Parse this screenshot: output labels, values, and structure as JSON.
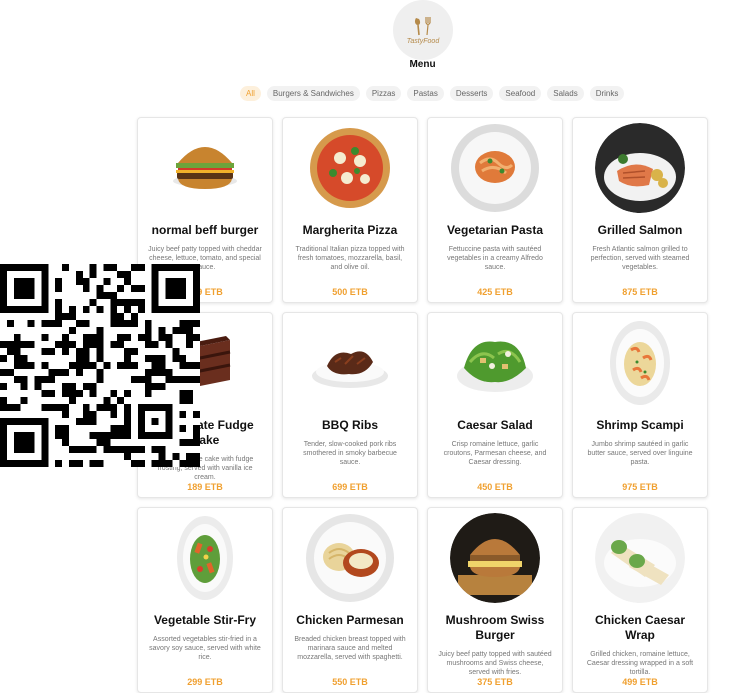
{
  "header": {
    "logo_text": "TastyFood",
    "title": "Menu"
  },
  "tabs": [
    {
      "label": "All",
      "active": true
    },
    {
      "label": "Burgers & Sandwiches"
    },
    {
      "label": "Pizzas"
    },
    {
      "label": "Pastas"
    },
    {
      "label": "Desserts"
    },
    {
      "label": "Seafood"
    },
    {
      "label": "Salads"
    },
    {
      "label": "Drinks"
    }
  ],
  "items": [
    {
      "name": "normal beff burger",
      "desc": "Juicy beef patty topped with cheddar cheese, lettuce, tomato, and special sauce.",
      "price": "299 ETB",
      "icon": "burger-image"
    },
    {
      "name": "Margherita Pizza",
      "desc": "Traditional Italian pizza topped with fresh tomatoes, mozzarella, basil, and olive oil.",
      "price": "500 ETB",
      "icon": "pizza-image"
    },
    {
      "name": "Vegetarian Pasta",
      "desc": "Fettuccine pasta with sautéed vegetables in a creamy Alfredo sauce.",
      "price": "425 ETB",
      "icon": "pasta-image"
    },
    {
      "name": "Grilled Salmon",
      "desc": "Fresh Atlantic salmon grilled to perfection, served with steamed vegetables.",
      "price": "875 ETB",
      "icon": "salmon-image"
    },
    {
      "name": "Chocolate Fudge Cake",
      "desc": "Rich chocolate cake with fudge frosting, served with vanilla ice cream.",
      "price": "189 ETB",
      "icon": "cake-image"
    },
    {
      "name": "BBQ Ribs",
      "desc": "Tender, slow-cooked pork ribs smothered in smoky barbecue sauce.",
      "price": "699 ETB",
      "icon": "ribs-image"
    },
    {
      "name": "Caesar Salad",
      "desc": "Crisp romaine lettuce, garlic croutons, Parmesan cheese, and Caesar dressing.",
      "price": "450 ETB",
      "icon": "salad-image"
    },
    {
      "name": "Shrimp Scampi",
      "desc": "Jumbo shrimp sautéed in garlic butter sauce, served over linguine pasta.",
      "price": "975 ETB",
      "icon": "shrimp-image"
    },
    {
      "name": "Vegetable Stir-Fry",
      "desc": "Assorted vegetables stir-fried in a savory soy sauce, served with white rice.",
      "price": "299 ETB",
      "icon": "stirfry-image"
    },
    {
      "name": "Chicken Parmesan",
      "desc": "Breaded chicken breast topped with marinara sauce and melted mozzarella, served with spaghetti.",
      "price": "550 ETB",
      "icon": "chicken-parm-image"
    },
    {
      "name": "Mushroom Swiss Burger",
      "desc": "Juicy beef patty topped with sautéed mushrooms and Swiss cheese, served with fries.",
      "price": "375 ETB",
      "icon": "mushroom-burger-image"
    },
    {
      "name": "Chicken Caesar Wrap",
      "desc": "Grilled chicken, romaine lettuce, Caesar dressing wrapped in a soft tortilla.",
      "price": "499 ETB",
      "icon": "wrap-image"
    }
  ],
  "qr_overlay": {
    "icon": "qr-code-icon"
  }
}
